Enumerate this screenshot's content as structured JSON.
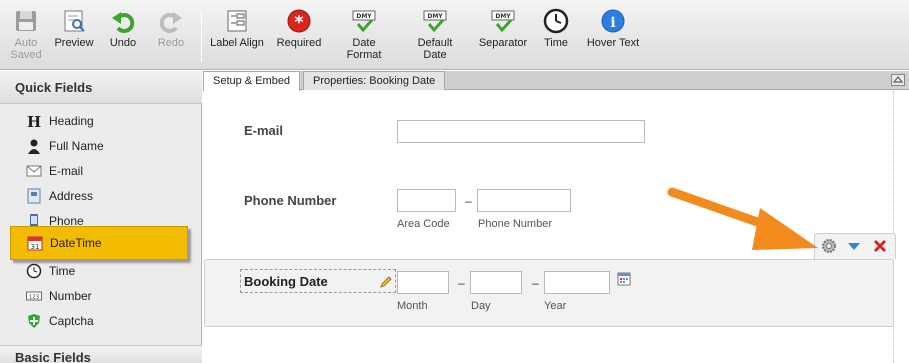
{
  "toolbar": {
    "auto_saved": "Auto\nSaved",
    "preview": "Preview",
    "undo": "Undo",
    "redo": "Redo",
    "label_align": "Label Align",
    "required": "Required",
    "date_format": "Date\nFormat",
    "default_date": "Default\nDate",
    "separator": "Separator",
    "time": "Time",
    "hover_text": "Hover Text",
    "dmy_badge": "DMY"
  },
  "sidebar": {
    "title": "Quick Fields",
    "items": [
      {
        "label": "Heading",
        "icon": "heading-icon"
      },
      {
        "label": "Full Name",
        "icon": "person-icon"
      },
      {
        "label": "E-mail",
        "icon": "envelope-icon"
      },
      {
        "label": "Address",
        "icon": "address-icon"
      },
      {
        "label": "Phone",
        "icon": "phone-icon"
      },
      {
        "label": "DateTime",
        "icon": "calendar-icon"
      },
      {
        "label": "Time",
        "icon": "clock-icon"
      },
      {
        "label": "Number",
        "icon": "number-icon"
      },
      {
        "label": "Captcha",
        "icon": "shield-icon"
      }
    ],
    "active_item": "DateTime",
    "basic_title": "Basic Fields"
  },
  "tabs": [
    "Setup & Embed",
    "Properties: Booking Date"
  ],
  "form": {
    "email_label": "E-mail",
    "phone_label": "Phone Number",
    "area_code_sub": "Area Code",
    "phone_number_sub": "Phone Number",
    "dash": "–",
    "booking_label": "Booking Date",
    "month_sub": "Month",
    "day_sub": "Day",
    "year_sub": "Year"
  },
  "colors": {
    "active_item": "#f2bd00",
    "arrow": "#f28a1e",
    "required_red": "#d9261c",
    "undo_green": "#3da52b"
  }
}
